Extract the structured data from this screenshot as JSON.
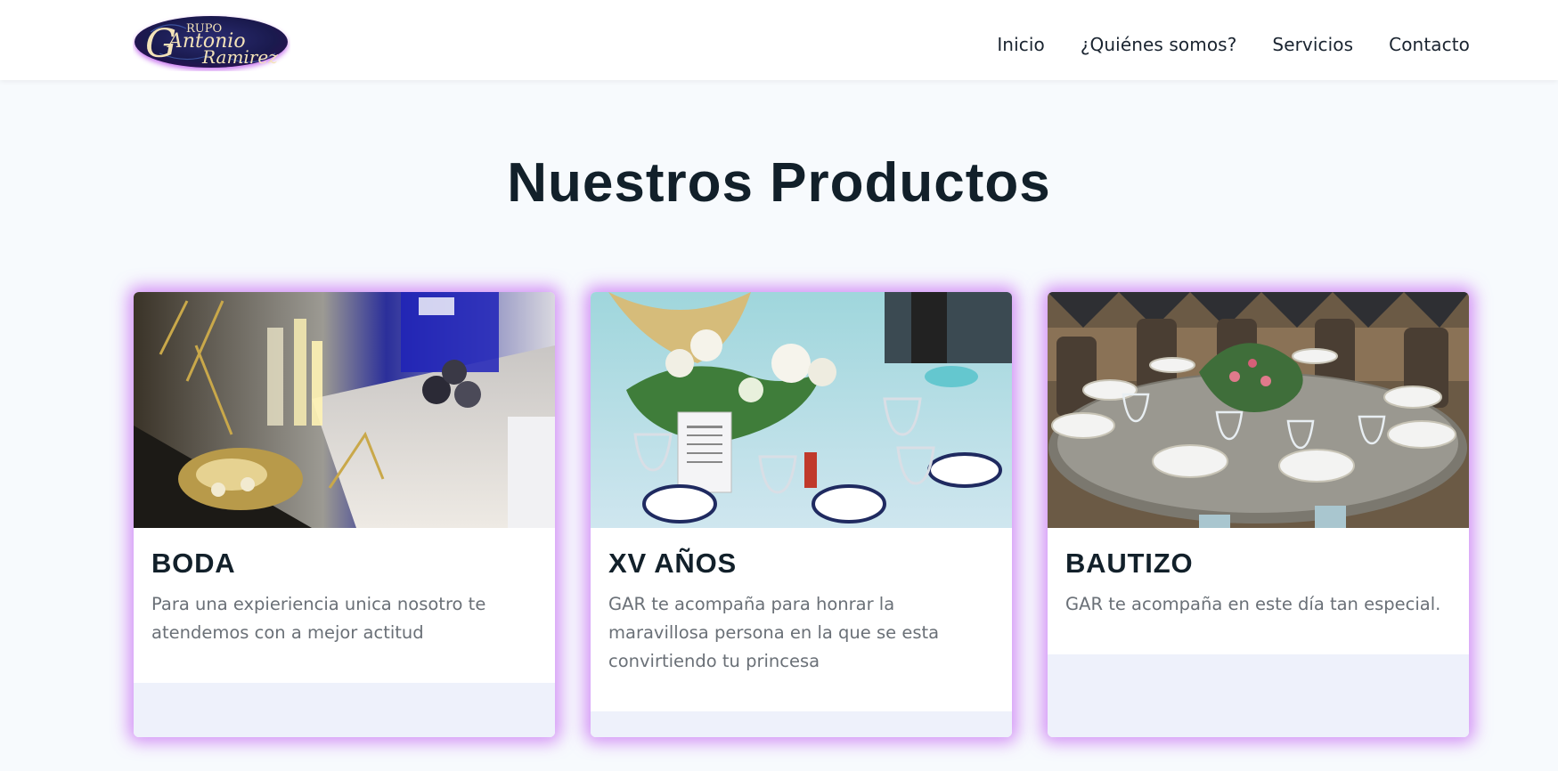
{
  "header": {
    "logo": {
      "alt": "Grupo Antonio Ramirez",
      "line1": "RUPO",
      "line2": "Antonio",
      "line3": "Ramirez"
    },
    "nav": [
      {
        "label": "Inicio"
      },
      {
        "label": "¿Quiénes somos?"
      },
      {
        "label": "Servicios"
      },
      {
        "label": "Contacto"
      }
    ]
  },
  "products": {
    "title": "Nuestros Productos",
    "cards": [
      {
        "title": "BODA",
        "description": "Para una expieriencia unica nosotro te atendemos con a mejor actitud"
      },
      {
        "title": "XV AÑOS",
        "description": "GAR te acompaña para honrar la maravillosa persona en la que se esta convirtiendo tu princesa"
      },
      {
        "title": "BAUTIZO",
        "description": "GAR te acompaña en este día tan especial."
      }
    ]
  },
  "colors": {
    "accent_glow": "#b63cf0",
    "title": "#12202a",
    "text_muted": "#6a7077",
    "card_footer": "#eef1fb"
  }
}
